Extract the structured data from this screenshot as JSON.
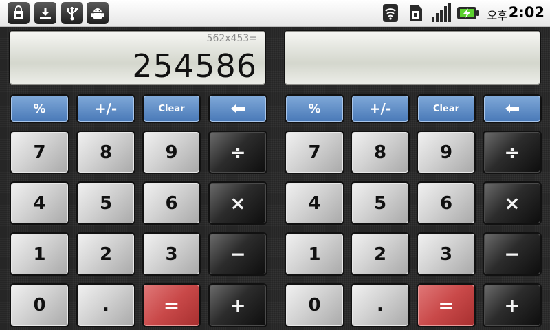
{
  "status_bar": {
    "left_icons": [
      "bag-notification-icon",
      "download-icon",
      "usb-icon",
      "android-icon"
    ],
    "right_icons": [
      "wifi-icon",
      "sim-icon",
      "signal-icon",
      "battery-charging-icon"
    ],
    "ampm": "오후",
    "time": "2:02"
  },
  "left_calc": {
    "expression": "562x453=",
    "result": "254586",
    "keys": {
      "percent": "%",
      "plusminus": "+/-",
      "clear": "Clear",
      "back": "←",
      "seven": "7",
      "eight": "8",
      "nine": "9",
      "divide": "÷",
      "four": "4",
      "five": "5",
      "six": "6",
      "multiply": "×",
      "one": "1",
      "two": "2",
      "three": "3",
      "minus": "−",
      "zero": "0",
      "dot": ".",
      "equals": "=",
      "plus": "+"
    }
  },
  "right_calc": {
    "expression": "",
    "result": "",
    "keys": {
      "percent": "%",
      "plusminus": "+/-",
      "clear": "Clear",
      "back": "←",
      "seven": "7",
      "eight": "8",
      "nine": "9",
      "divide": "÷",
      "four": "4",
      "five": "5",
      "six": "6",
      "multiply": "×",
      "one": "1",
      "two": "2",
      "three": "3",
      "minus": "−",
      "zero": "0",
      "dot": ".",
      "equals": "=",
      "plus": "+"
    }
  },
  "colors": {
    "function_key": "#5f8fc8",
    "number_key": "#cfcfcf",
    "operator_key": "#1e1e1e",
    "equals_key": "#c94949",
    "display": "#e2e4dd"
  }
}
